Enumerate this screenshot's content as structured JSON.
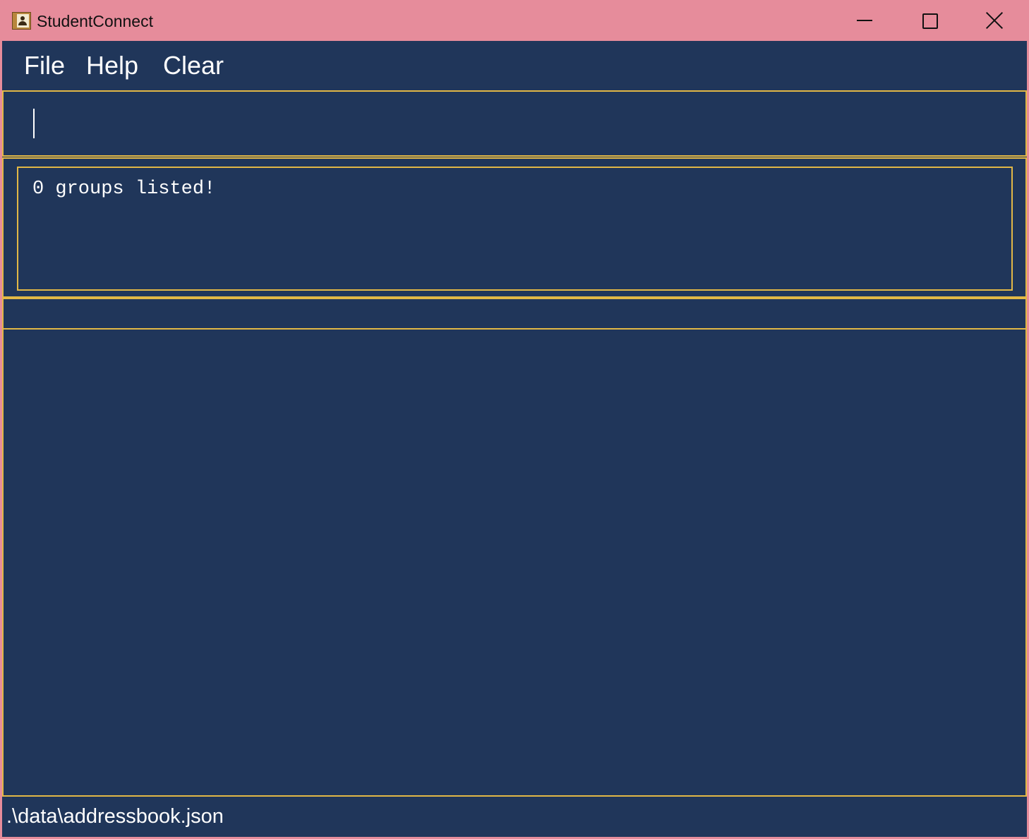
{
  "window": {
    "title": "StudentConnect",
    "icon": "address-book-icon",
    "controls": {
      "minimize_icon": "minimize-icon",
      "maximize_icon": "maximize-icon",
      "close_icon": "close-icon"
    }
  },
  "menu": {
    "items": [
      {
        "label": "File"
      },
      {
        "label": "Help"
      },
      {
        "label": "Clear"
      }
    ]
  },
  "command_box": {
    "value": ""
  },
  "result_display": {
    "text": "0 groups listed!"
  },
  "status_bar": {
    "file_path": ".\\data\\addressbook.json"
  },
  "colors": {
    "titlebar": "#e68c9b",
    "background": "#20365a",
    "border_accent": "#e2b846",
    "text": "#ffffff"
  }
}
